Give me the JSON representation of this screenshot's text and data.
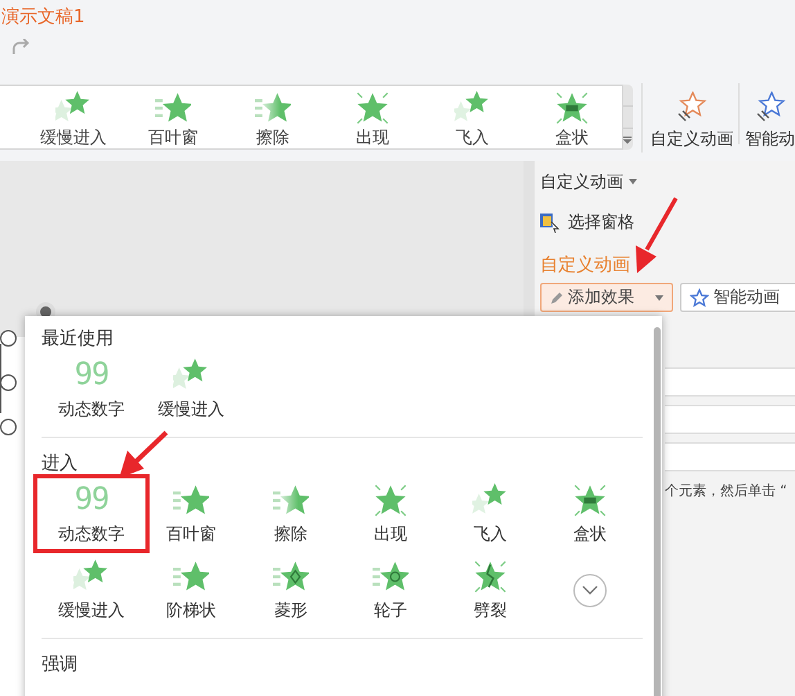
{
  "title_bar": {
    "title": "演示文稿1"
  },
  "ribbon": {
    "gallery": [
      {
        "label": "缓慢进入",
        "kind": "slow"
      },
      {
        "label": "百叶窗",
        "kind": "blinds"
      },
      {
        "label": "擦除",
        "kind": "wipe"
      },
      {
        "label": "出现",
        "kind": "appear"
      },
      {
        "label": "飞入",
        "kind": "fly"
      },
      {
        "label": "盒状",
        "kind": "box"
      }
    ],
    "buttons": [
      {
        "label": "自定义动画",
        "kind": "custom"
      },
      {
        "label": "智能动",
        "kind": "smart"
      }
    ]
  },
  "task_pane": {
    "title": "自定义动画",
    "selection_pane": "选择窗格",
    "section": "自定义动画",
    "add_effect": "添加效果",
    "smart_animation": "智能动画",
    "hint": "个元素，然后单击 “"
  },
  "effect_menu": {
    "groups": [
      {
        "title": "最近使用",
        "items": [
          {
            "label": "动态数字",
            "kind": "digits",
            "glyph": "99",
            "highlighted": false
          },
          {
            "label": "缓慢进入",
            "kind": "slow",
            "highlighted": false
          }
        ]
      },
      {
        "title": "进入",
        "has_more": true,
        "items": [
          {
            "label": "动态数字",
            "kind": "digits",
            "glyph": "99",
            "highlighted": true
          },
          {
            "label": "百叶窗",
            "kind": "blinds",
            "highlighted": false
          },
          {
            "label": "擦除",
            "kind": "wipe",
            "highlighted": false
          },
          {
            "label": "出现",
            "kind": "appear",
            "highlighted": false
          },
          {
            "label": "飞入",
            "kind": "fly",
            "highlighted": false
          },
          {
            "label": "盒状",
            "kind": "box",
            "highlighted": false
          },
          {
            "label": "缓慢进入",
            "kind": "slow",
            "highlighted": false
          },
          {
            "label": "阶梯状",
            "kind": "stairs",
            "highlighted": false
          },
          {
            "label": "菱形",
            "kind": "diamond",
            "highlighted": false
          },
          {
            "label": "轮子",
            "kind": "wheel",
            "highlighted": false
          },
          {
            "label": "劈裂",
            "kind": "split",
            "highlighted": false
          }
        ]
      },
      {
        "title": "强调"
      }
    ]
  }
}
